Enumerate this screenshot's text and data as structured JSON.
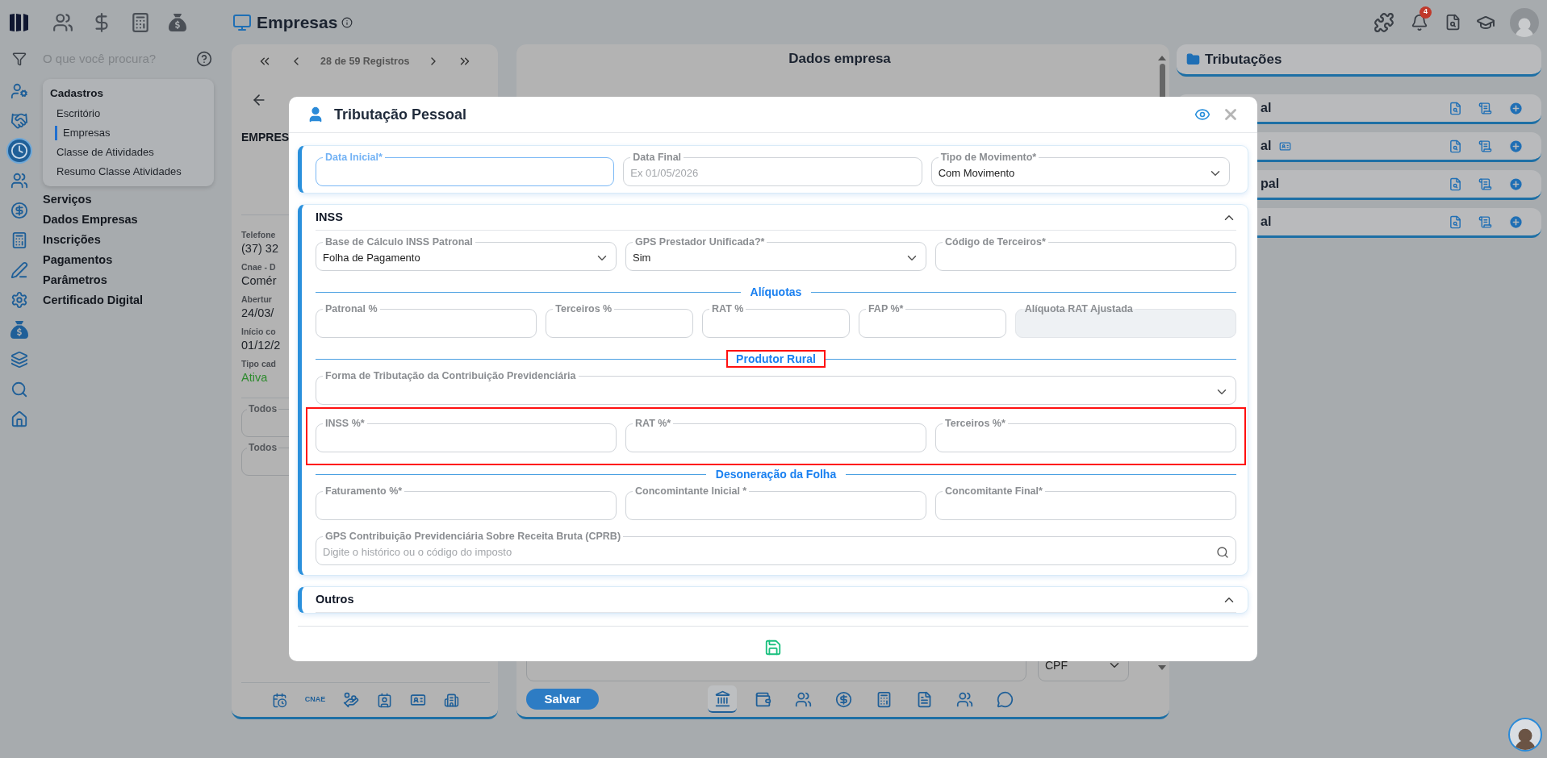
{
  "header": {
    "title": "Empresas",
    "notifications": "4"
  },
  "search": {
    "placeholder": "O que você procura?"
  },
  "nav_rail": [
    {
      "selected": false
    },
    {
      "selected": false
    },
    {
      "selected": true
    },
    {
      "selected": false
    },
    {
      "selected": false
    },
    {
      "selected": false
    },
    {
      "selected": false
    },
    {
      "selected": false
    },
    {
      "selected": false
    },
    {
      "selected": false
    },
    {
      "selected": false
    },
    {
      "selected": false
    }
  ],
  "menu": {
    "group": "Cadastros",
    "items": [
      {
        "label": "Escritório",
        "selected": false
      },
      {
        "label": "Empresas",
        "selected": true
      },
      {
        "label": "Classe de Atividades",
        "selected": false
      },
      {
        "label": "Resumo Classe Atividades",
        "selected": false
      }
    ],
    "sections": [
      "Serviços",
      "Dados Empresas",
      "Inscrições",
      "Pagamentos",
      "Parâmetros",
      "Certificado Digital"
    ]
  },
  "record_panel": {
    "counter": "28 de 59 Registros",
    "title": "EMPRES",
    "details": [
      {
        "label": "Telefone",
        "value": "(37) 32",
        "kind": "text"
      },
      {
        "label": "Cnae - D",
        "value": "Comér",
        "kind": "text"
      },
      {
        "label": "Abertur",
        "value": "24/03/",
        "kind": "text"
      },
      {
        "label": "Início co",
        "value": "01/12/2",
        "kind": "text"
      },
      {
        "label": "Tipo cad",
        "value": "Ativa",
        "kind": "status"
      }
    ],
    "filters": [
      "Todos",
      "Todos"
    ],
    "toolbar_label": "CNAE"
  },
  "company_panel": {
    "title": "Dados empresa",
    "document_type": "CPF",
    "save": "Salvar",
    "tabs": [
      {
        "selected": true
      },
      {
        "selected": false
      },
      {
        "selected": false
      },
      {
        "selected": false
      },
      {
        "selected": false
      },
      {
        "selected": false
      },
      {
        "selected": false
      },
      {
        "selected": false
      }
    ]
  },
  "taxes_panel": {
    "title": "Tributações",
    "rows": [
      {
        "label": "al",
        "badge": false
      },
      {
        "label": "al",
        "badge": true
      },
      {
        "label": "pal",
        "badge": false
      },
      {
        "label": "al",
        "badge": false
      }
    ]
  },
  "modal": {
    "title": "Tributação Pessoal",
    "period": {
      "fields": [
        {
          "label": "Data Inicial*",
          "kind": "date",
          "focused": true,
          "disabled": false
        },
        {
          "label": "Data Final",
          "kind": "date",
          "placeholder": "Ex 01/05/2026",
          "focused": false,
          "disabled": false
        },
        {
          "label": "Tipo de Movimento*",
          "kind": "select",
          "value": "Com Movimento",
          "focused": false,
          "disabled": false
        }
      ]
    },
    "sections": [
      {
        "title": "INSS",
        "expanded": true,
        "blocks": [
          {
            "kind": "fields",
            "highlighted": false,
            "fields": [
              {
                "label": "Base de Cálculo INSS Patronal",
                "kind": "select",
                "value": "Folha de Pagamento",
                "disabled": false
              },
              {
                "label": "GPS Prestador Unificada?*",
                "kind": "select",
                "value": "Sim",
                "disabled": false
              },
              {
                "label": "Código de Terceiros*",
                "kind": "text",
                "disabled": false
              }
            ]
          },
          {
            "kind": "divider",
            "label": "Alíquotas",
            "highlighted": false
          },
          {
            "kind": "fields",
            "highlighted": false,
            "fields": [
              {
                "label": "Patronal %",
                "kind": "text",
                "disabled": false
              },
              {
                "label": "Terceiros %",
                "kind": "text",
                "disabled": false
              },
              {
                "label": "RAT %",
                "kind": "text",
                "disabled": false
              },
              {
                "label": "FAP %*",
                "kind": "text",
                "disabled": false
              },
              {
                "label": "Alíquota RAT Ajustada",
                "kind": "text",
                "disabled": true
              }
            ]
          },
          {
            "kind": "divider",
            "label": "Produtor Rural",
            "highlighted": true
          },
          {
            "kind": "fields",
            "highlighted": false,
            "fields": [
              {
                "label": "Forma de Tributação da Contribuição Previdenciária",
                "kind": "select",
                "disabled": false
              }
            ]
          },
          {
            "kind": "fields",
            "highlighted": true,
            "fields": [
              {
                "label": "INSS %*",
                "kind": "text",
                "disabled": false
              },
              {
                "label": "RAT %*",
                "kind": "text",
                "disabled": false
              },
              {
                "label": "Terceiros %*",
                "kind": "text",
                "disabled": false
              }
            ]
          },
          {
            "kind": "divider",
            "label": "Desoneração da Folha",
            "highlighted": false
          },
          {
            "kind": "fields",
            "highlighted": false,
            "fields": [
              {
                "label": "Faturamento %*",
                "kind": "text",
                "disabled": false
              },
              {
                "label": "Concomintante Inicial *",
                "kind": "text",
                "disabled": false
              },
              {
                "label": "Concomitante Final*",
                "kind": "text",
                "disabled": false
              }
            ]
          },
          {
            "kind": "fields",
            "highlighted": false,
            "fields": [
              {
                "label": "GPS Contribuição Previdenciária Sobre Receita Bruta (CPRB)",
                "kind": "search",
                "placeholder": "Digite o histórico ou o código do imposto",
                "disabled": false
              }
            ]
          }
        ]
      },
      {
        "title": "Outros",
        "expanded": true
      }
    ]
  }
}
